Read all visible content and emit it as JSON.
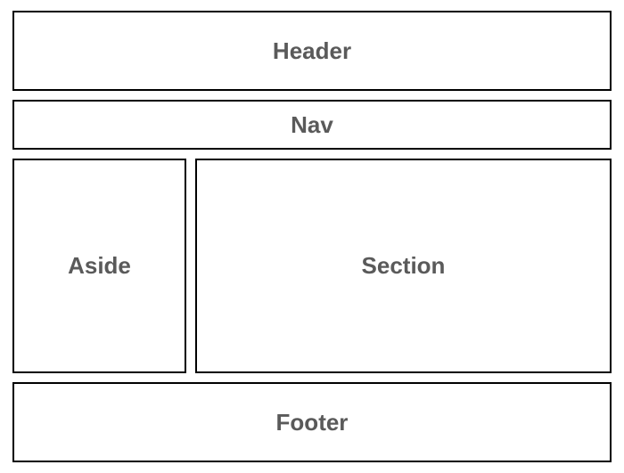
{
  "layout": {
    "header": {
      "label": "Header"
    },
    "nav": {
      "label": "Nav"
    },
    "aside": {
      "label": "Aside"
    },
    "section": {
      "label": "Section"
    },
    "footer": {
      "label": "Footer"
    }
  }
}
